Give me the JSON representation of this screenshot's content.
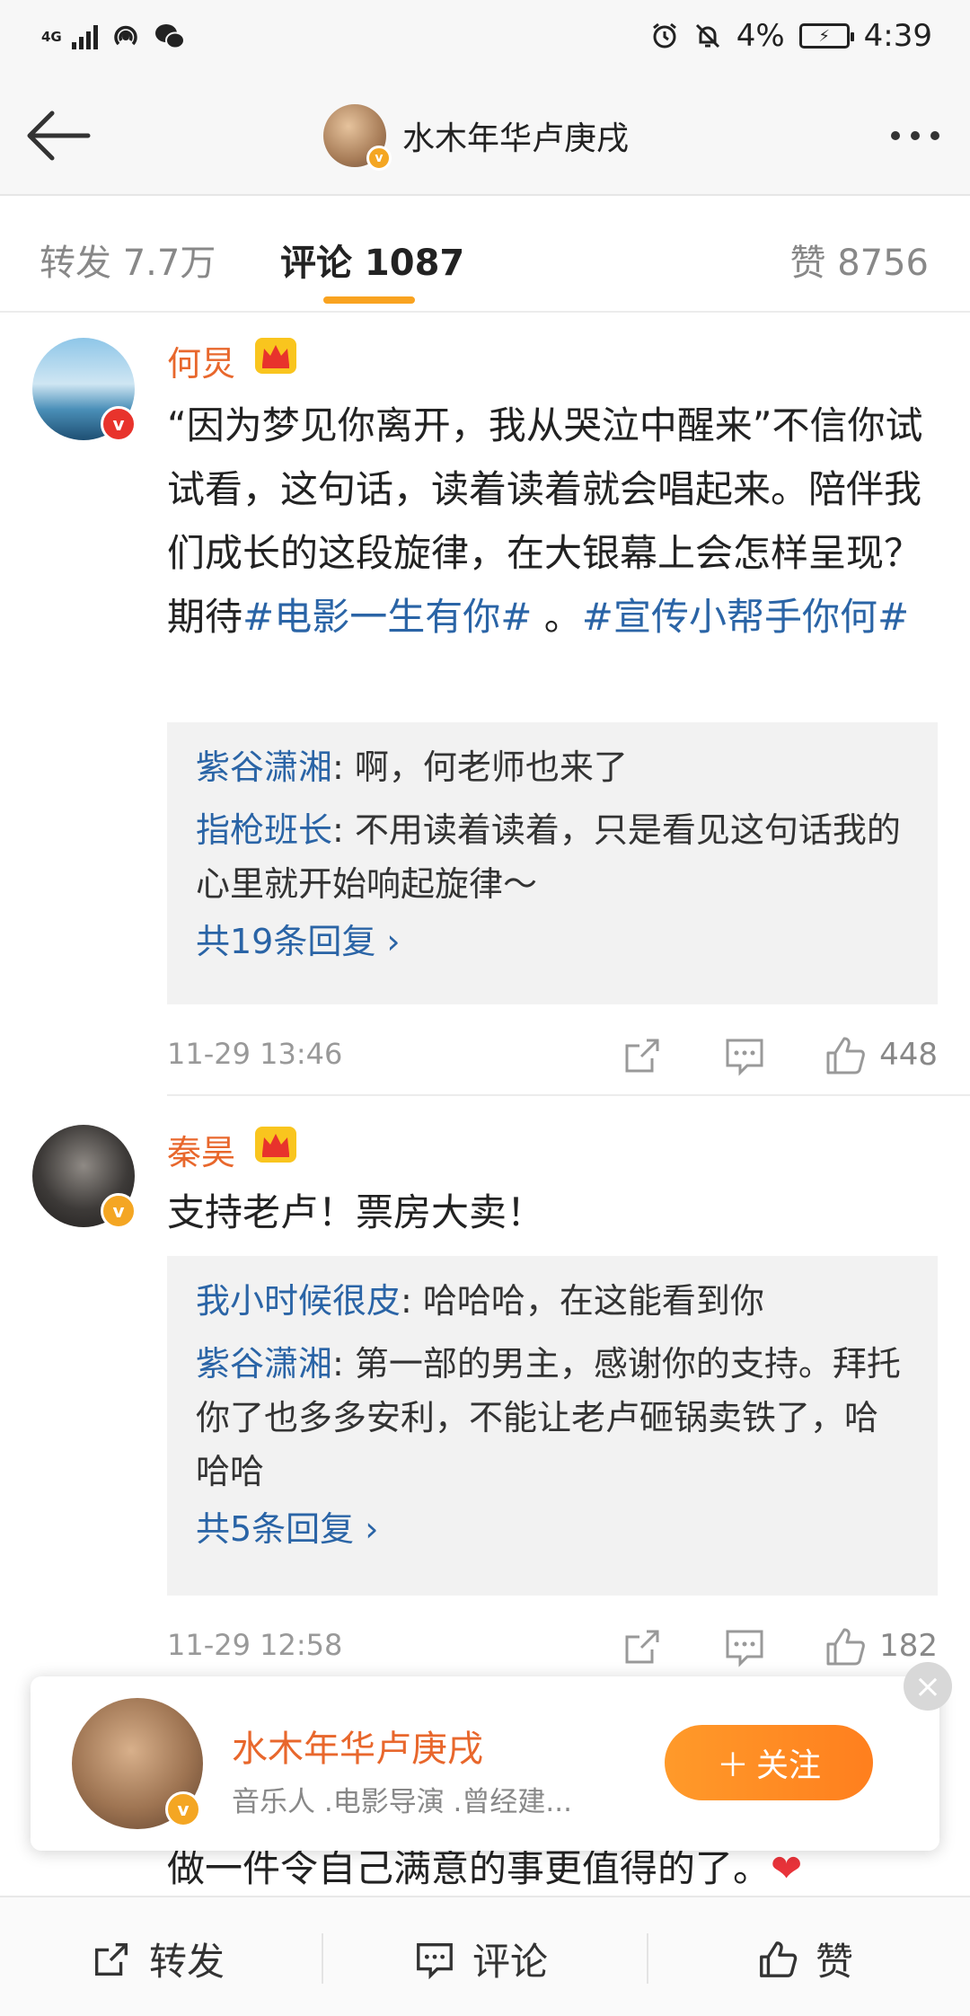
{
  "status_bar": {
    "network": "4G",
    "battery": "4%",
    "time": "4:39"
  },
  "nav": {
    "title": "水木年华卢庚戌"
  },
  "tabs": {
    "forward": "转发 7.7万",
    "comment": "评论 1087",
    "like": "赞 8756"
  },
  "comments": [
    {
      "username": "何炅",
      "text_plain": "“因为梦见你离开，我从哭泣中醒来”不信你试试看，这句话，读着读着就会唱起来。陪伴我们成长的这段旋律，在大银幕上会怎样呈现？期待",
      "tag1": "#电影一生有你#",
      "tag_sep": " 。",
      "tag2": "#宣传小帮手你何#",
      "replies": [
        {
          "user": "紫谷潇湘",
          "text": ": 啊，何老师也来了"
        },
        {
          "user": "指枪班长",
          "text": ": 不用读着读着，只是看见这句话我的心里就开始响起旋律～"
        }
      ],
      "more_replies": "共19条回复 ›",
      "time": "11-29 13:46",
      "likes": "448"
    },
    {
      "username": "秦昊",
      "text_plain": "支持老卢！票房大卖！",
      "replies": [
        {
          "user": "我小时候很皮",
          "text": ": 哈哈哈，在这能看到你"
        },
        {
          "user": "紫谷潇湘",
          "text": ": 第一部的男主，感谢你的支持。拜托你了也多多安利，不能让老卢砸锅卖铁了，哈哈哈"
        }
      ],
      "more_replies": "共5条回复 ›",
      "time": "11-29 12:58",
      "likes": "182"
    }
  ],
  "partial_comment": {
    "text": "做一件令自己满意的事更值得的了。"
  },
  "follow_card": {
    "name": "水木年华卢庚戌",
    "description": "音乐人 .电影导演 .曾经建...",
    "follow_label": "关注"
  },
  "bottom_bar": {
    "forward": "转发",
    "comment": "评论",
    "like": "赞"
  },
  "colors": {
    "accent": "#f9a320",
    "username": "#e8672c",
    "link": "#2a64a6"
  }
}
